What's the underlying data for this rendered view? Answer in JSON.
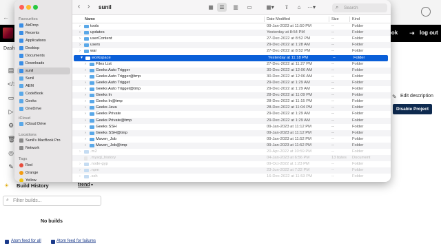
{
  "colors": {
    "accent": "#0a5fd8",
    "folder": "#5aa8e8",
    "jenkins_header": "#000000",
    "disable_button": "#0e2a4f",
    "tag_red": "#e74c3c",
    "tag_orange": "#f39c12",
    "tag_yellow": "#f1c40f"
  },
  "background": {
    "back_arrow": "←",
    "header_link_book": "ook",
    "logout": "log out",
    "dash": "Dash",
    "edit_description": "Edit description",
    "disable_project": "Disable Project",
    "build_history": "Build History",
    "trend": "trend",
    "filter_placeholder": "Filter builds...",
    "no_builds": "No builds",
    "atom_all": "Atom feed for all",
    "atom_failures": "Atom feed for failures"
  },
  "finder": {
    "title": "sunil",
    "search_placeholder": "Search",
    "sidebar": {
      "favourites_label": "Favourites",
      "favourites": [
        "AirDrop",
        "Recents",
        "Applications",
        "Desktop",
        "Documents",
        "Downloads",
        "sunil",
        "Sunil",
        "AEM",
        "CodeBook",
        "Geeks",
        "OneDrive"
      ],
      "icloud_label": "iCloud",
      "icloud": [
        "iCloud Drive"
      ],
      "locations_label": "Locations",
      "locations": [
        "Sunil's MacBook Pro",
        "Network"
      ],
      "tags_label": "Tags",
      "tags": [
        "Red",
        "Orange",
        "Yellow"
      ]
    },
    "columns": {
      "name": "Name",
      "date": "Date Modified",
      "size": "Size",
      "kind": "Kind"
    },
    "rows": [
      {
        "name": "tools",
        "date": "09-Jan-2023 at 11:50 PM",
        "size": "--",
        "kind": "Folder"
      },
      {
        "name": "updates",
        "date": "Yesterday at 8:54 PM",
        "size": "--",
        "kind": "Folder"
      },
      {
        "name": "userContent",
        "date": "27-Dec-2022 at 8:52 PM",
        "size": "--",
        "kind": "Folder"
      },
      {
        "name": "users",
        "date": "29-Dec-2022 at 1:28 AM",
        "size": "--",
        "kind": "Folder"
      },
      {
        "name": "war",
        "date": "27-Dec-2022 at 8:52 PM",
        "size": "--",
        "kind": "Folder"
      },
      {
        "name": "workspace",
        "date": "Yesterday at 11:18 PM",
        "size": "--",
        "kind": "Folder"
      },
      {
        "name": "Files List",
        "date": "27-Dec-2022 at 11:27 PM",
        "size": "--",
        "kind": "Folder"
      },
      {
        "name": "Geeks Auto Trigger",
        "date": "30-Dec-2022 at 12:06 AM",
        "size": "--",
        "kind": "Folder"
      },
      {
        "name": "Geeks Auto Trigger@tmp",
        "date": "30-Dec-2022 at 12:06 AM",
        "size": "--",
        "kind": "Folder"
      },
      {
        "name": "Geeks Auto Trigget",
        "date": "29-Dec-2022 at 1:29 AM",
        "size": "--",
        "kind": "Folder"
      },
      {
        "name": "Geeks Auto Trigget@tmp",
        "date": "29-Dec-2022 at 1:29 AM",
        "size": "--",
        "kind": "Folder"
      },
      {
        "name": "Geeks In",
        "date": "28-Dec-2022 at 11:09 PM",
        "size": "--",
        "kind": "Folder"
      },
      {
        "name": "Geeks In@tmp",
        "date": "28-Dec-2022 at 11:15 PM",
        "size": "--",
        "kind": "Folder"
      },
      {
        "name": "Geeks Java",
        "date": "28-Dec-2022 at 11:04 PM",
        "size": "--",
        "kind": "Folder"
      },
      {
        "name": "Geeks Private",
        "date": "29-Dec-2022 at 1:29 AM",
        "size": "--",
        "kind": "Folder"
      },
      {
        "name": "Geeks Private@tmp",
        "date": "29-Dec-2022 at 1:29 AM",
        "size": "--",
        "kind": "Folder"
      },
      {
        "name": "Geeks SSH",
        "date": "09-Jan-2023 at 11:12 PM",
        "size": "--",
        "kind": "Folder"
      },
      {
        "name": "Geeks SSH@tmp",
        "date": "09-Jan-2023 at 11:12 PM",
        "size": "--",
        "kind": "Folder"
      },
      {
        "name": "Maven_Job",
        "date": "09-Jan-2023 at 11:52 PM",
        "size": "--",
        "kind": "Folder"
      },
      {
        "name": "Maven_Job@tmp",
        "date": "09-Jan-2023 at 11:52 PM",
        "size": "--",
        "kind": "Folder"
      },
      {
        "name": ".m2",
        "date": "20-Apr-2022 at 10:59 PM",
        "size": "--",
        "kind": "Folder"
      },
      {
        "name": ".mysql_history",
        "date": "04-Jan-2023 at 6:56 PM",
        "size": "13 bytes",
        "kind": "Document"
      },
      {
        "name": ".node-gyp",
        "date": "09-Oct-2022 at 1:23 PM",
        "size": "--",
        "kind": "Folder"
      },
      {
        "name": ".npm",
        "date": "23-Jun-2022 at 7:22 PM",
        "size": "--",
        "kind": "Folder"
      },
      {
        "name": ".ssh",
        "date": "16-Dec-2022 at 11:53 PM",
        "size": "--",
        "kind": "Folder"
      }
    ]
  }
}
